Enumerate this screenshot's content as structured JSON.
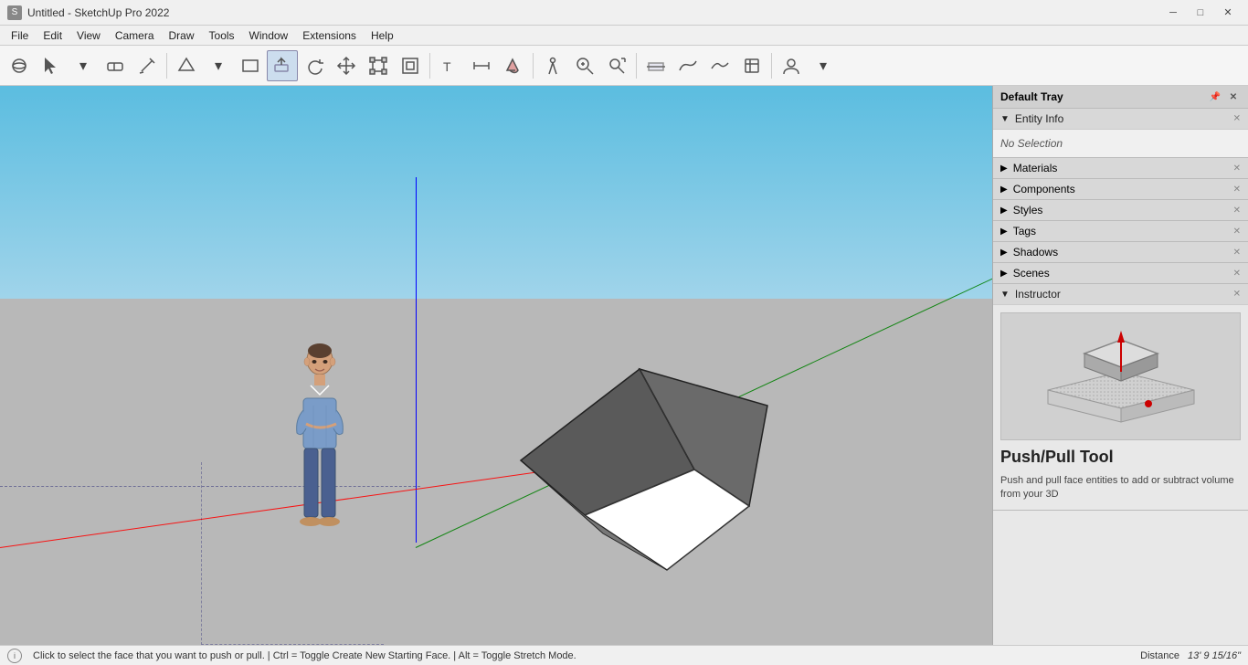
{
  "titlebar": {
    "title": "Untitled - SketchUp Pro 2022",
    "min_label": "─",
    "max_label": "□",
    "close_label": "✕"
  },
  "menubar": {
    "items": [
      "File",
      "Edit",
      "View",
      "Camera",
      "Draw",
      "Tools",
      "Window",
      "Extensions",
      "Help"
    ]
  },
  "toolbar": {
    "tools": [
      {
        "name": "orbit",
        "label": "⊙"
      },
      {
        "name": "select",
        "label": "↖"
      },
      {
        "name": "eraser",
        "label": "◻"
      },
      {
        "name": "pencil",
        "label": "✏"
      },
      {
        "name": "shape",
        "label": "◆"
      },
      {
        "name": "rectangle",
        "label": "▭"
      },
      {
        "name": "pushpull",
        "label": "⬡"
      },
      {
        "name": "rotate",
        "label": "↺"
      },
      {
        "name": "move",
        "label": "✛"
      },
      {
        "name": "scale",
        "label": "⬡"
      },
      {
        "name": "offset",
        "label": "▣"
      },
      {
        "name": "text",
        "label": "T"
      },
      {
        "name": "dimension",
        "label": "↔"
      },
      {
        "name": "paint",
        "label": "🪣"
      },
      {
        "name": "walk",
        "label": "🚶"
      },
      {
        "name": "zoom",
        "label": "🔍"
      },
      {
        "name": "zoom-ext",
        "label": "⊞"
      },
      {
        "name": "section",
        "label": "◫"
      },
      {
        "name": "sandbox",
        "label": "≋"
      },
      {
        "name": "smooth",
        "label": "≋"
      },
      {
        "name": "profile",
        "label": "≋"
      },
      {
        "name": "user",
        "label": "👤"
      }
    ]
  },
  "right_panel": {
    "header": "Default Tray",
    "pin_label": "📌",
    "close_label": "✕",
    "entity_info": {
      "label": "Entity Info",
      "no_selection": "No Selection"
    },
    "panels": [
      {
        "name": "Materials",
        "collapsed": true
      },
      {
        "name": "Components",
        "collapsed": true
      },
      {
        "name": "Styles",
        "collapsed": true
      },
      {
        "name": "Tags",
        "collapsed": true
      },
      {
        "name": "Shadows",
        "collapsed": true
      },
      {
        "name": "Scenes",
        "collapsed": true
      },
      {
        "name": "Instructor",
        "collapsed": false
      }
    ],
    "instructor": {
      "title": "Push/Pull Tool",
      "description": "Push and pull face entities to add or subtract volume from your 3D"
    }
  },
  "statusbar": {
    "info_icon": "i",
    "message": "Click to select the face that you want to push or pull. | Ctrl = Toggle Create New Starting Face. | Alt = Toggle Stretch Mode.",
    "distance_label": "Distance",
    "distance_value": "13' 9 15/16\""
  }
}
